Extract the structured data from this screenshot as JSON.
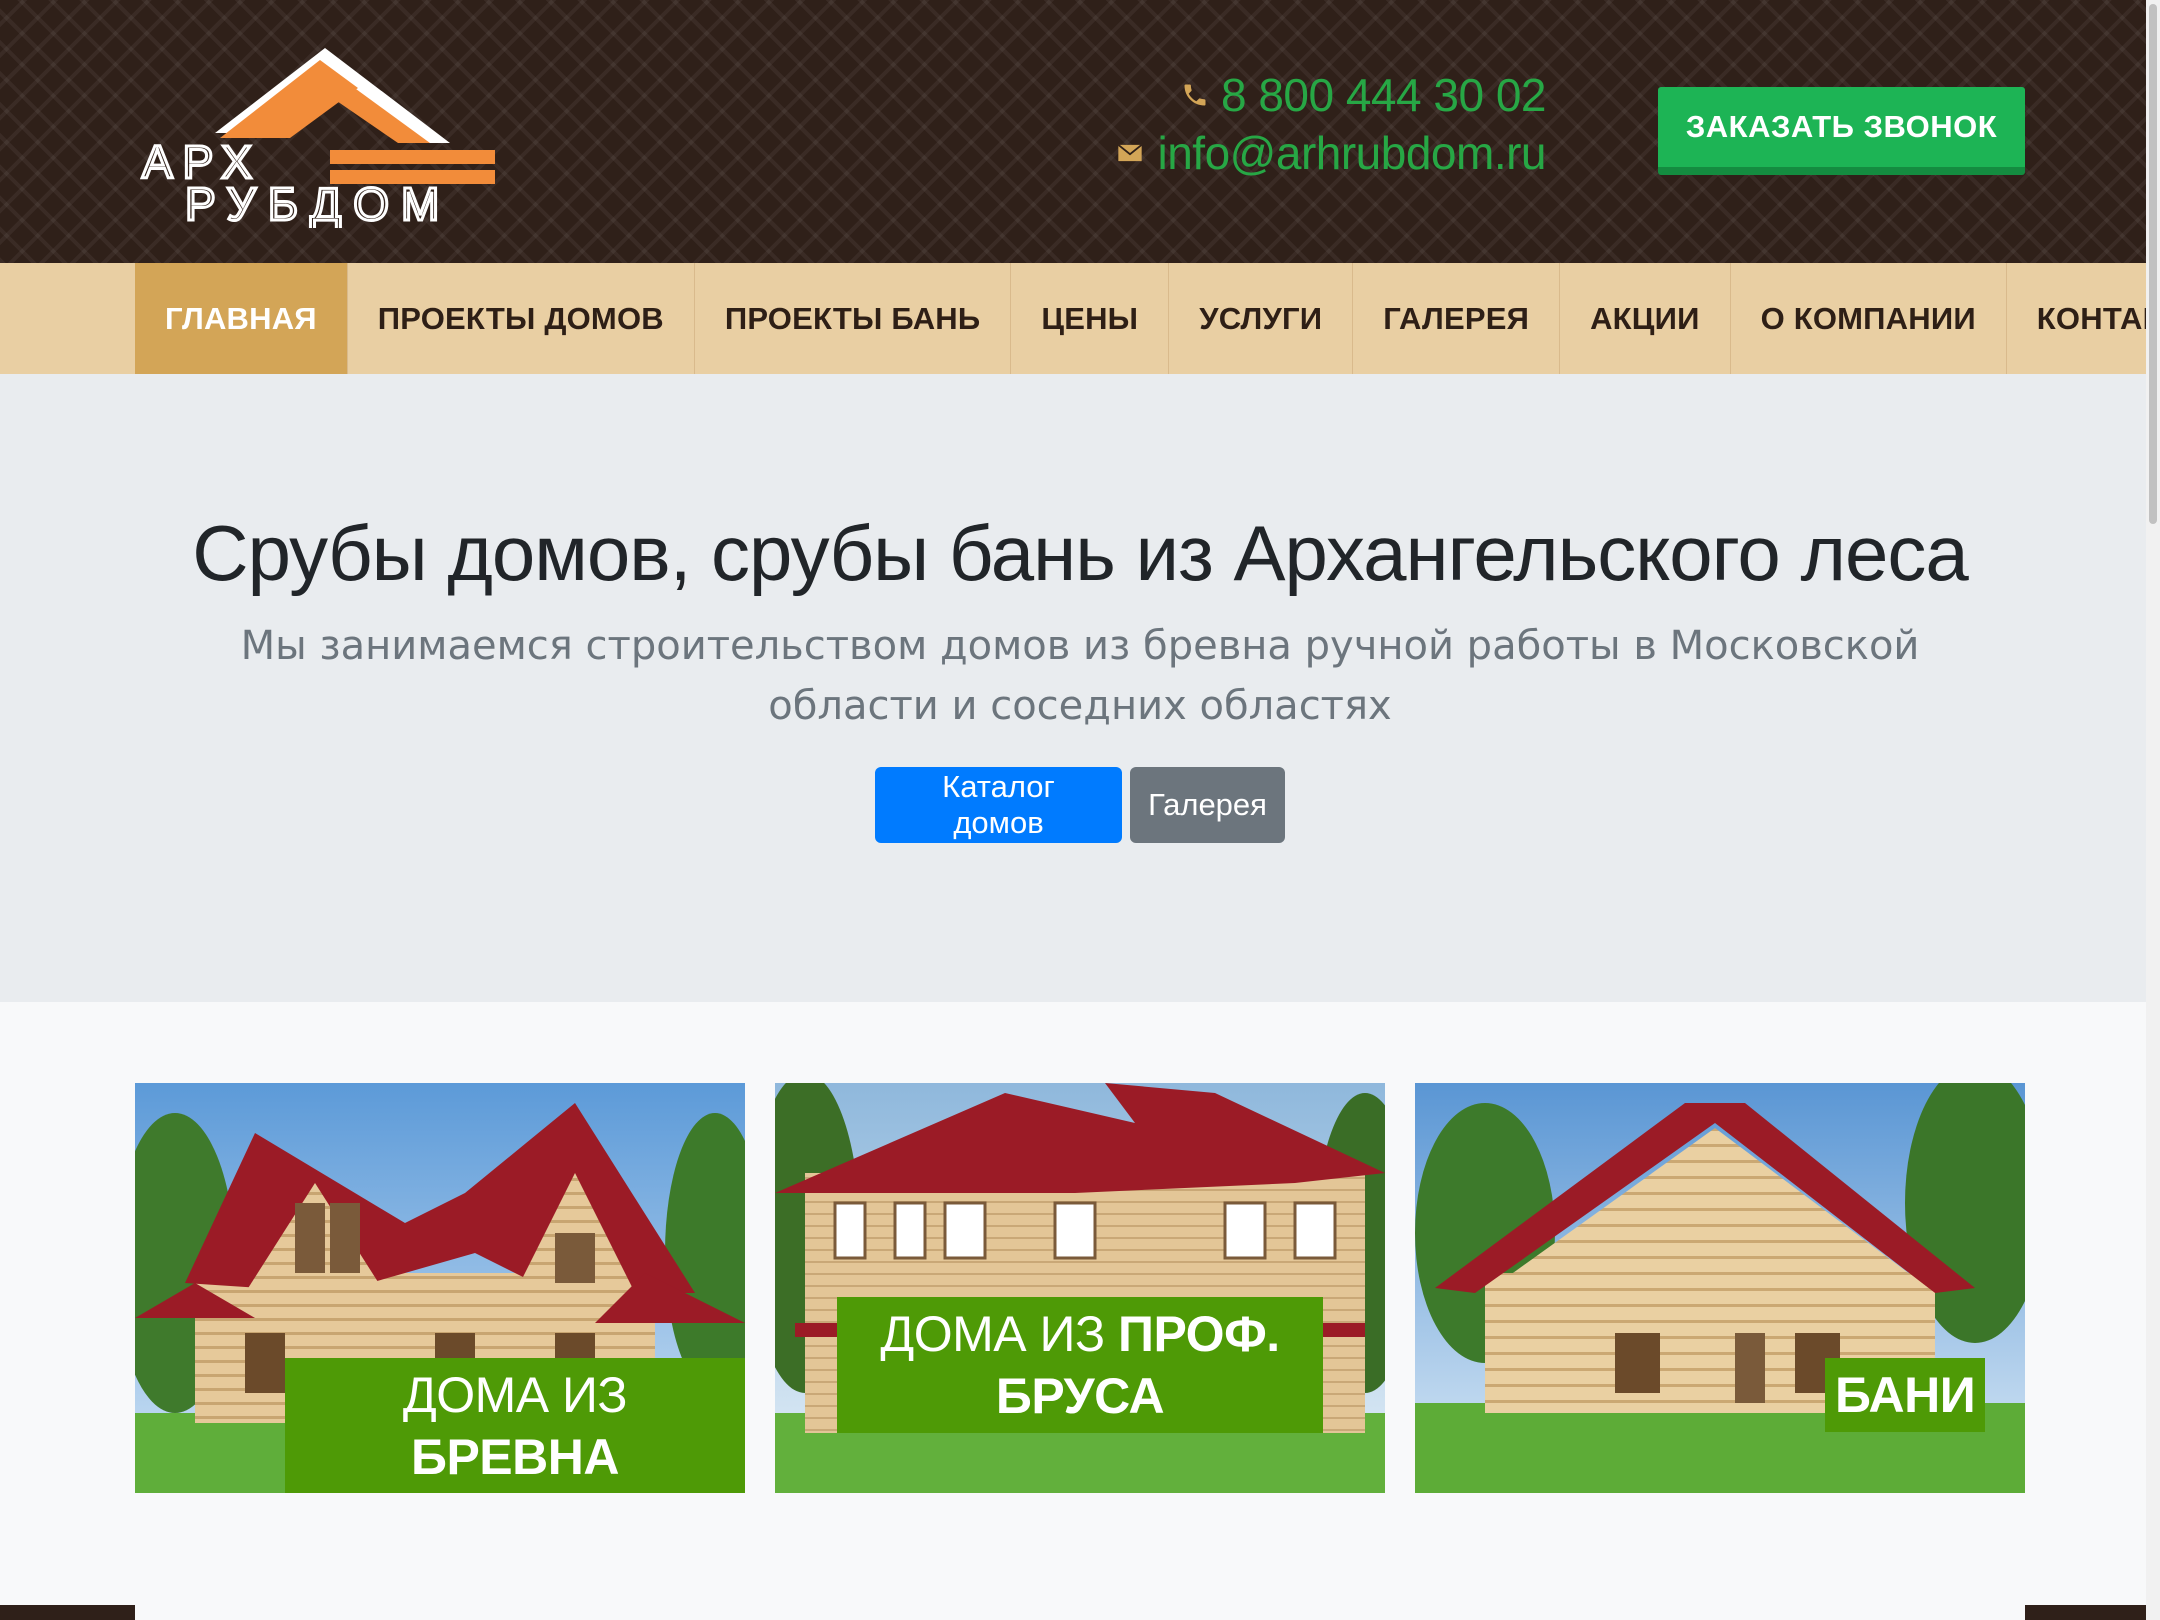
{
  "header": {
    "logo_text_top": "АРХ",
    "logo_text_bottom": "РУБДОМ",
    "phone": "8 800 444 30 02",
    "email": "info@arhrubdom.ru",
    "call_button": "ЗАКАЗАТЬ ЗВОНОК",
    "accent_color": "#f28c3a",
    "contact_color": "#27a745"
  },
  "nav": {
    "items": [
      {
        "label": "ГЛАВНАЯ",
        "active": true
      },
      {
        "label": "ПРОЕКТЫ ДОМОВ"
      },
      {
        "label": "ПРОЕКТЫ БАНЬ"
      },
      {
        "label": "ЦЕНЫ"
      },
      {
        "label": "УСЛУГИ"
      },
      {
        "label": "ГАЛЕРЕЯ"
      },
      {
        "label": "АКЦИИ"
      },
      {
        "label": "О КОМПАНИИ"
      },
      {
        "label": "КОНТАКТЫ"
      }
    ]
  },
  "hero": {
    "title": "Срубы домов, срубы бань из Архангельского леса",
    "subtitle": "Мы занимаемся строительством домов из бревна ручной работы в Московской области и соседних областях",
    "primary_button": "Каталог домов",
    "secondary_button": "Галерея"
  },
  "cards": [
    {
      "label_thin": "ДОМА ИЗ ",
      "label_bold": "БРЕВНА",
      "image": "log-house-photo"
    },
    {
      "label_thin": "ДОМА ИЗ ",
      "label_bold": "ПРОФ. БРУСА",
      "image": "timber-house-photo"
    },
    {
      "label_thin": "",
      "label_bold": "БАНИ",
      "image": "bathhouse-photo"
    }
  ]
}
